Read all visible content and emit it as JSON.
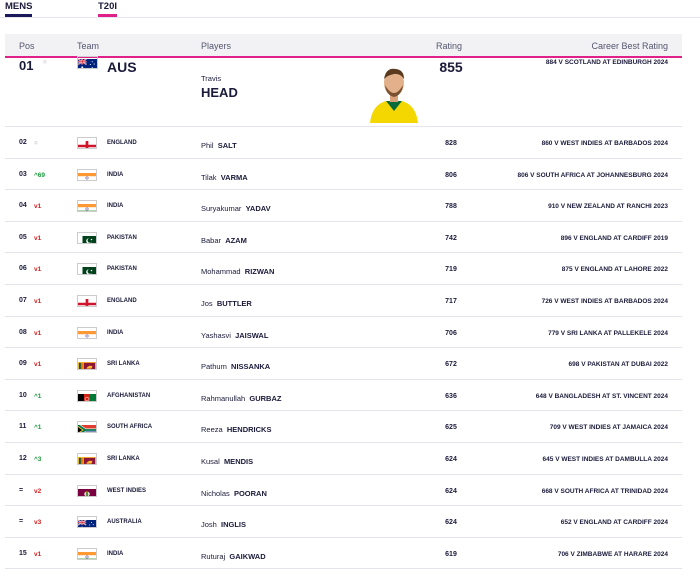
{
  "tabs": [
    {
      "label": "MENS",
      "active": true
    },
    {
      "label": "T20I",
      "active": true
    }
  ],
  "table": {
    "headers": {
      "pos": "Pos",
      "team": "Team",
      "players": "Players",
      "rating": "Rating",
      "career_best": "Career Best Rating"
    },
    "rows": [
      {
        "pos": "01",
        "movement": "=",
        "trend": "same",
        "team": "AUS",
        "flag": "australia",
        "first_name": "Travis",
        "last_name": "HEAD",
        "rating": "855",
        "career_best": "884 V SCOTLAND AT EDINBURGH 2024"
      },
      {
        "pos": "02",
        "movement": "=",
        "trend": "same",
        "team": "ENGLAND",
        "flag": "england",
        "first_name": "Phil",
        "last_name": "SALT",
        "rating": "828",
        "career_best": "860 V WEST INDIES AT BARBADOS 2024"
      },
      {
        "pos": "03",
        "movement": "^69",
        "trend": "up",
        "team": "INDIA",
        "flag": "india",
        "first_name": "Tilak",
        "last_name": "VARMA",
        "rating": "806",
        "career_best": "806 V SOUTH AFRICA AT JOHANNESBURG 2024"
      },
      {
        "pos": "04",
        "movement": "v1",
        "trend": "down",
        "team": "INDIA",
        "flag": "india",
        "first_name": "Suryakumar",
        "last_name": "YADAV",
        "rating": "788",
        "career_best": "910 V NEW ZEALAND AT RANCHI 2023"
      },
      {
        "pos": "05",
        "movement": "v1",
        "trend": "down",
        "team": "PAKISTAN",
        "flag": "pakistan",
        "first_name": "Babar",
        "last_name": "AZAM",
        "rating": "742",
        "career_best": "896 V ENGLAND AT CARDIFF 2019"
      },
      {
        "pos": "06",
        "movement": "v1",
        "trend": "down",
        "team": "PAKISTAN",
        "flag": "pakistan",
        "first_name": "Mohammad",
        "last_name": "RIZWAN",
        "rating": "719",
        "career_best": "875 V ENGLAND AT LAHORE 2022"
      },
      {
        "pos": "07",
        "movement": "v1",
        "trend": "down",
        "team": "ENGLAND",
        "flag": "england",
        "first_name": "Jos",
        "last_name": "BUTTLER",
        "rating": "717",
        "career_best": "726 V WEST INDIES AT BARBADOS 2024"
      },
      {
        "pos": "08",
        "movement": "v1",
        "trend": "down",
        "team": "INDIA",
        "flag": "india",
        "first_name": "Yashasvi",
        "last_name": "JAISWAL",
        "rating": "706",
        "career_best": "779 V SRI LANKA AT PALLEKELE 2024"
      },
      {
        "pos": "09",
        "movement": "v1",
        "trend": "down",
        "team": "SRI LANKA",
        "flag": "srilanka",
        "first_name": "Pathum",
        "last_name": "NISSANKA",
        "rating": "672",
        "career_best": "698 V PAKISTAN AT DUBAI 2022"
      },
      {
        "pos": "10",
        "movement": "^1",
        "trend": "up",
        "team": "AFGHANISTAN",
        "flag": "afghanistan",
        "first_name": "Rahmanullah",
        "last_name": "GURBAZ",
        "rating": "636",
        "career_best": "648 V BANGLADESH AT ST. VINCENT 2024"
      },
      {
        "pos": "11",
        "movement": "^1",
        "trend": "up",
        "team": "SOUTH AFRICA",
        "flag": "southafrica",
        "first_name": "Reeza",
        "last_name": "HENDRICKS",
        "rating": "625",
        "career_best": "709 V WEST INDIES AT JAMAICA 2024"
      },
      {
        "pos": "12",
        "movement": "^3",
        "trend": "up",
        "team": "SRI LANKA",
        "flag": "srilanka",
        "first_name": "Kusal",
        "last_name": "MENDIS",
        "rating": "624",
        "career_best": "645 V WEST INDIES AT DAMBULLA 2024"
      },
      {
        "pos": "=",
        "movement": "v2",
        "trend": "down",
        "team": "WEST INDIES",
        "flag": "westindies",
        "first_name": "Nicholas",
        "last_name": "POORAN",
        "rating": "624",
        "career_best": "668 V SOUTH AFRICA AT TRINIDAD 2024"
      },
      {
        "pos": "=",
        "movement": "v3",
        "trend": "down",
        "team": "AUSTRALIA",
        "flag": "australia",
        "first_name": "Josh",
        "last_name": "INGLIS",
        "rating": "624",
        "career_best": "652 V ENGLAND AT CARDIFF 2024"
      },
      {
        "pos": "15",
        "movement": "v1",
        "trend": "down",
        "team": "INDIA",
        "flag": "india",
        "first_name": "Ruturaj",
        "last_name": "GAIKWAD",
        "rating": "619",
        "career_best": "706 V ZIMBABWE AT HARARE 2024"
      }
    ]
  },
  "colors": {
    "accent": "#e0218a",
    "navy": "#1a1a5a",
    "up": "#1a9a3a",
    "down": "#d42020"
  }
}
